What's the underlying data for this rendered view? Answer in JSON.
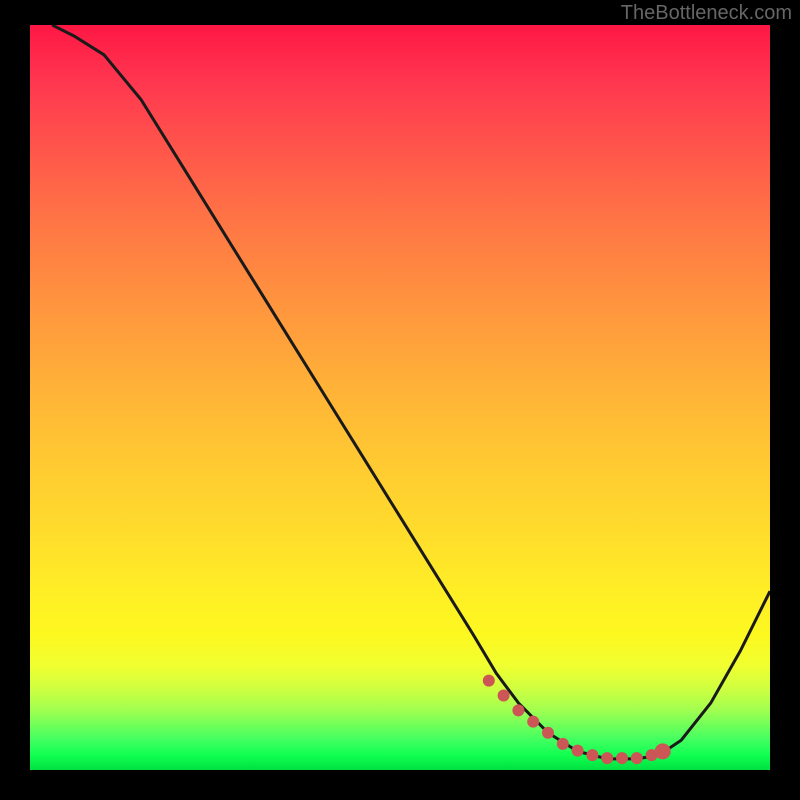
{
  "watermark": "TheBottleneck.com",
  "chart_data": {
    "type": "line",
    "title": "",
    "xlabel": "",
    "ylabel": "",
    "xlim": [
      0,
      100
    ],
    "ylim": [
      0,
      100
    ],
    "series": [
      {
        "name": "curve",
        "x": [
          3,
          6,
          10,
          15,
          20,
          25,
          30,
          35,
          40,
          45,
          50,
          55,
          60,
          63,
          66,
          70,
          74,
          78,
          82,
          85,
          88,
          92,
          96,
          100
        ],
        "y": [
          100,
          98.5,
          96,
          90,
          82,
          74,
          66,
          58,
          50,
          42,
          34,
          26,
          18,
          13,
          9,
          5,
          2.5,
          1.5,
          1.5,
          2,
          4,
          9,
          16,
          24
        ]
      }
    ],
    "markers": {
      "name": "highlight",
      "x": [
        62,
        64,
        66,
        68,
        70,
        72,
        74,
        76,
        78,
        80,
        82,
        84,
        85.5
      ],
      "y": [
        12,
        10,
        8,
        6.5,
        5,
        3.5,
        2.6,
        2,
        1.6,
        1.6,
        1.6,
        2,
        2.5
      ],
      "size": [
        6,
        6,
        6,
        6,
        6,
        6,
        6,
        6,
        6,
        6,
        6,
        6,
        8
      ]
    }
  }
}
